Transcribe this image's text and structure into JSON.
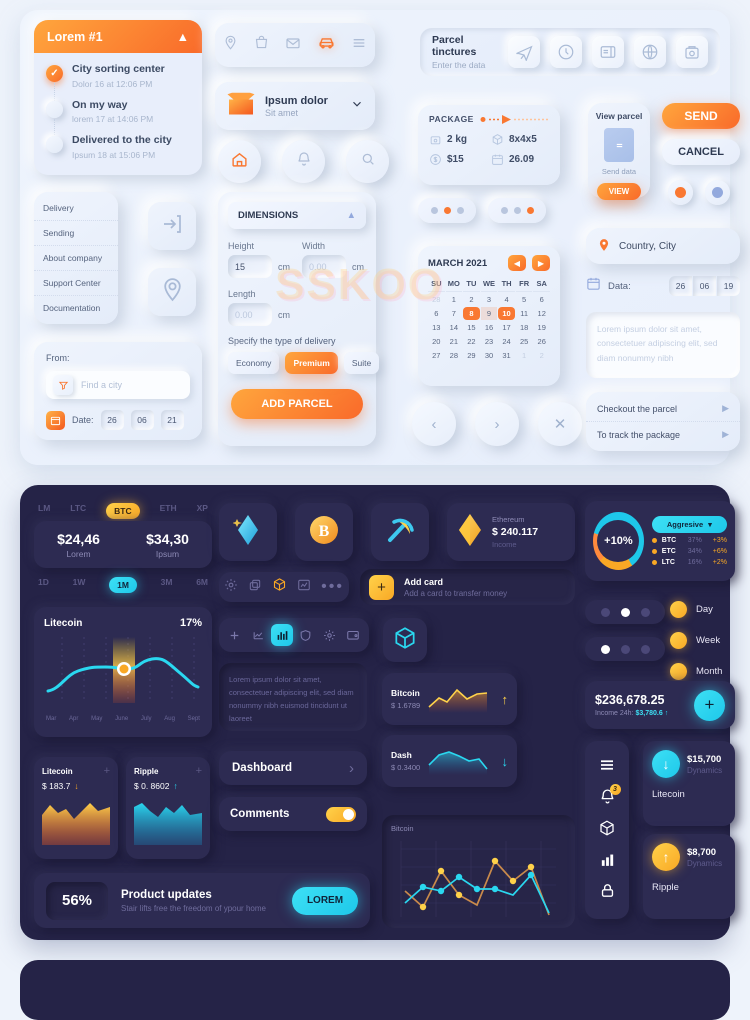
{
  "light": {
    "tracking": {
      "title": "Lorem #1",
      "steps": [
        {
          "title": "City sorting center",
          "sub": "Dolor 16 at 12:06 PM"
        },
        {
          "title": "On my way",
          "sub": "lorem 17 at 14:06 PM"
        },
        {
          "title": "Delivered to the city",
          "sub": "Ipsum 18 at 15:06 PM"
        }
      ]
    },
    "iconbar": [
      "location-icon",
      "bag-icon",
      "mail-icon",
      "car-icon",
      "menu-icon"
    ],
    "parcel_select": {
      "title": "Ipsum dolor",
      "sub": "Sit amet"
    },
    "round_buttons": [
      "home-icon",
      "bell-icon",
      "search-icon"
    ],
    "tinctures": {
      "title": "Parcel tinctures",
      "sub": "Enter the data",
      "icons": [
        "plane-icon",
        "clock-icon",
        "card-icon",
        "globe-icon",
        "scale-icon"
      ]
    },
    "package": {
      "label": "PACKAGE",
      "weight": "2 kg",
      "size": "8x4x5",
      "price": "$15",
      "date": "26.09"
    },
    "view_parcel": {
      "title": "View parcel",
      "sub": "Send data",
      "button": "VIEW"
    },
    "send_label": "SEND",
    "cancel_label": "CANCEL",
    "menu": [
      "Delivery",
      "Sending",
      "About company",
      "Support Center",
      "Documentation"
    ],
    "from": {
      "label": "From:",
      "placeholder": "Find a city",
      "date_label": "Date:",
      "date": [
        "26",
        "06",
        "21"
      ]
    },
    "dimensions": {
      "title": "DIMENSIONS",
      "height_label": "Height",
      "height_value": "15",
      "width_label": "Width",
      "width_value": "0.00",
      "length_label": "Length",
      "length_value": "0.00",
      "unit": "cm",
      "delivery_label": "Specify the type of delivery",
      "types": [
        "Economy",
        "Premium",
        "Suite"
      ],
      "selected_type": "Premium",
      "add_button": "ADD PARCEL"
    },
    "calendar": {
      "month": "MARCH 2021",
      "dow": [
        "SU",
        "MO",
        "TU",
        "WE",
        "TH",
        "FR",
        "SA"
      ],
      "weeks": [
        [
          "28",
          "1",
          "2",
          "3",
          "4",
          "5",
          "6"
        ],
        [
          "6",
          "7",
          "8",
          "9",
          "10",
          "11",
          "12"
        ],
        [
          "13",
          "14",
          "15",
          "16",
          "17",
          "18",
          "19"
        ],
        [
          "20",
          "21",
          "22",
          "23",
          "24",
          "25",
          "26"
        ],
        [
          "27",
          "28",
          "29",
          "30",
          "31",
          "1",
          "2"
        ]
      ],
      "selected_range": [
        "8",
        "9",
        "10"
      ]
    },
    "nav_circles": [
      "prev-icon",
      "next-icon",
      "close-icon"
    ],
    "country": "Country, City",
    "data_label": "Data:",
    "data_values": [
      "26",
      "06",
      "19"
    ],
    "textarea": "Lorem ipsum dolor sit amet, consectetuer adipiscing elit, sed diam nonummy nibh",
    "links": [
      "Checkout the parcel",
      "To track the package"
    ]
  },
  "dark": {
    "crypto_tabs": [
      "LM",
      "LTC",
      "BTC",
      "ETH",
      "XP"
    ],
    "crypto_active": "BTC",
    "prices": [
      {
        "value": "$24,46",
        "label": "Lorem"
      },
      {
        "value": "$34,30",
        "label": "Ipsum"
      }
    ],
    "timeframes": [
      "1D",
      "1W",
      "1M",
      "3M",
      "6M"
    ],
    "timeframe_active": "1M",
    "litecoin_chart": {
      "name": "Litecoin",
      "change": "17%"
    },
    "mini_cards": [
      {
        "name": "Litecoin",
        "price": "$ 183.7",
        "dir": "down"
      },
      {
        "name": "Ripple",
        "price": "$ 0. 8602",
        "dir": "up"
      }
    ],
    "product": {
      "pct": "56%",
      "title": "Product updates",
      "sub": "Stair lifts free the freedom of ypour home",
      "button": "LOREM"
    },
    "big_icons": [
      "diamond-icon",
      "bitcoin-icon",
      "pickaxe-icon"
    ],
    "ethereum": {
      "name": "Ethereum",
      "value": "$ 240.117",
      "sub": "Income"
    },
    "toolrow": [
      "gear-icon",
      "copy-icon",
      "hexagon-icon",
      "chart-icon",
      "more-icon"
    ],
    "add_card": {
      "title": "Add card",
      "sub": "Add a card to transfer money"
    },
    "navrow": [
      "plus-icon",
      "chart-line-icon",
      "bars-icon",
      "shield-icon",
      "gear-icon",
      "wallet-icon"
    ],
    "cube_icon": "cube-icon",
    "lorem": "Lorem ipsum dolor sit amet, consectetuer adipiscing elit, sed diam nonummy nibh euismod tincidunt ut laoreet",
    "dashboard": "Dashboard",
    "comments": "Comments",
    "coin_rows": [
      {
        "name": "Bitcoin",
        "price": "$ 1.6789",
        "dir": "up"
      },
      {
        "name": "Dash",
        "price": "$ 0.3400",
        "dir": "down"
      }
    ],
    "big_chart_title": "Bitcoin",
    "donut": {
      "value": "+10%",
      "dropdown": "Aggresive"
    },
    "legend": [
      {
        "name": "BTC",
        "pct": "37%",
        "chg": "+3%"
      },
      {
        "name": "ETC",
        "pct": "34%",
        "chg": "+6%"
      },
      {
        "name": "LTC",
        "pct": "16%",
        "chg": "+2%"
      }
    ],
    "periods": [
      "Day",
      "Week",
      "Month"
    ],
    "balance": {
      "value": "$236,678.25",
      "label": "Income 24h:",
      "income": "$3,780.6"
    },
    "vbar": [
      "menu-icon",
      "bell-icon",
      "hexagon-icon",
      "bars-chart-icon",
      "lock-icon"
    ],
    "bell_badge": "3",
    "dynamics": [
      {
        "value": "$15,700",
        "sub": "Dynamics",
        "name": "Litecoin",
        "dir": "down"
      },
      {
        "value": "$8,700",
        "sub": "Dynamics",
        "name": "Ripple",
        "dir": "up"
      }
    ]
  },
  "watermark": "SSKOO"
}
